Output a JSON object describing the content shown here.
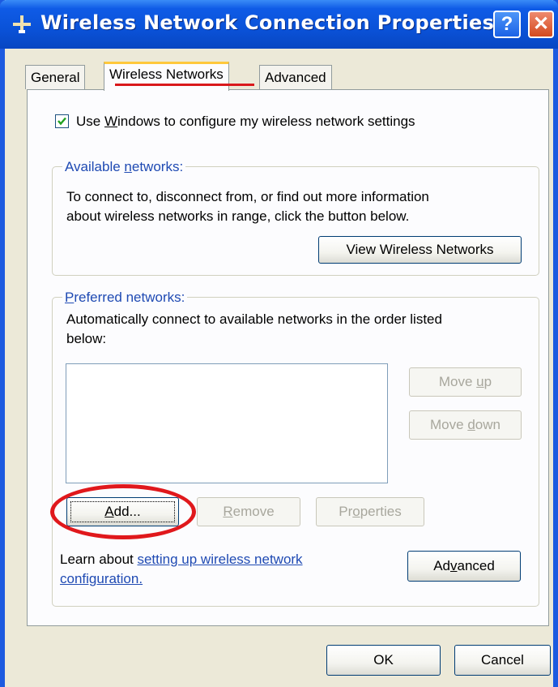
{
  "window": {
    "title": "Wireless Network Connection Properties",
    "help_icon": "help-icon",
    "close_icon": "close-icon",
    "title_icon": "network-icon"
  },
  "tabs": [
    {
      "label": "General",
      "active": false
    },
    {
      "label": "Wireless Networks",
      "active": true
    },
    {
      "label": "Advanced",
      "active": false
    }
  ],
  "use_windows": {
    "checked": true,
    "label_pre": "Use ",
    "label_accel": "W",
    "label_post": "indows to configure my wireless network settings"
  },
  "available": {
    "legend_pre": "Available ",
    "legend_accel": "n",
    "legend_post": "etworks:",
    "desc_line1": "To connect to, disconnect from, or find out more information",
    "desc_line2": "about wireless networks in range, click the button below.",
    "view_button": "View Wireless Networks"
  },
  "preferred": {
    "legend_accel": "P",
    "legend_post": "referred networks:",
    "desc_line1": "Automatically connect to available networks in the order listed",
    "desc_line2": "below:",
    "move_up_pre": "Move ",
    "move_up_accel": "u",
    "move_up_post": "p",
    "move_down_pre": "Move ",
    "move_down_accel": "d",
    "move_down_post": "own",
    "add_accel": "A",
    "add_post": "dd...",
    "remove_accel": "R",
    "remove_post": "emove",
    "properties_pre": "Pr",
    "properties_accel": "o",
    "properties_post": "perties",
    "learn_text": "Learn about ",
    "learn_link_line1": "setting up wireless network",
    "learn_link_line2": "configuration.",
    "advanced_pre": "Ad",
    "advanced_accel": "v",
    "advanced_post": "anced"
  },
  "footer": {
    "ok": "OK",
    "cancel": "Cancel"
  },
  "colors": {
    "title_bar": "#0a52d8",
    "highlight": "#e0181c",
    "link": "#1f4ab3"
  }
}
